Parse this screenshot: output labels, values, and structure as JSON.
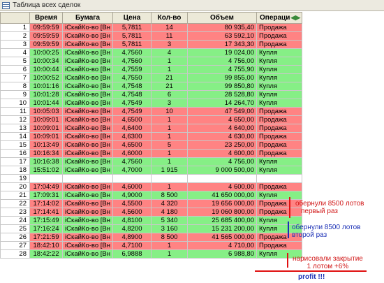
{
  "window": {
    "title": "Таблица всех сделок"
  },
  "table": {
    "columns": {
      "time": "Время",
      "security": "Бумага",
      "price": "Цена",
      "qty": "Кол-во",
      "volume": "Объем",
      "operation": "Операци"
    },
    "rows": [
      {
        "n": "1",
        "time": "09:59:59",
        "security": "iСкайКо-во [Вн",
        "price": "5,7811",
        "qty": "14",
        "volume": "80 935,40",
        "op": "Продажа",
        "side": "sell"
      },
      {
        "n": "2",
        "time": "09:59:59",
        "security": "iСкайКо-во [Вн",
        "price": "5,7811",
        "qty": "11",
        "volume": "63 592,10",
        "op": "Продажа",
        "side": "sell"
      },
      {
        "n": "3",
        "time": "09:59:59",
        "security": "iСкайКо-во [Вн",
        "price": "5,7811",
        "qty": "3",
        "volume": "17 343,30",
        "op": "Продажа",
        "side": "sell"
      },
      {
        "n": "4",
        "time": "10:00:25",
        "security": "iСкайКо-во [Вн",
        "price": "4,7560",
        "qty": "4",
        "volume": "19 024,00",
        "op": "Купля",
        "side": "buy"
      },
      {
        "n": "5",
        "time": "10:00:34",
        "security": "iСкайКо-во [Вн",
        "price": "4,7560",
        "qty": "1",
        "volume": "4 756,00",
        "op": "Купля",
        "side": "buy"
      },
      {
        "n": "6",
        "time": "10:00:44",
        "security": "iСкайКо-во [Вн",
        "price": "4,7559",
        "qty": "1",
        "volume": "4 755,90",
        "op": "Купля",
        "side": "buy"
      },
      {
        "n": "7",
        "time": "10:00:52",
        "security": "iСкайКо-во [Вн",
        "price": "4,7550",
        "qty": "21",
        "volume": "99 855,00",
        "op": "Купля",
        "side": "buy"
      },
      {
        "n": "8",
        "time": "10:01:16",
        "security": "iСкайКо-во [Вн",
        "price": "4,7548",
        "qty": "21",
        "volume": "99 850,80",
        "op": "Купля",
        "side": "buy"
      },
      {
        "n": "9",
        "time": "10:01:28",
        "security": "iСкайКо-во [Вн",
        "price": "4,7548",
        "qty": "6",
        "volume": "28 528,80",
        "op": "Купля",
        "side": "buy"
      },
      {
        "n": "10",
        "time": "10:01:44",
        "security": "iСкайКо-во [Вн",
        "price": "4,7549",
        "qty": "3",
        "volume": "14 264,70",
        "op": "Купля",
        "side": "buy"
      },
      {
        "n": "11",
        "time": "10:05:03",
        "security": "iСкайКо-во [Вн",
        "price": "4,7549",
        "qty": "10",
        "volume": "47 549,00",
        "op": "Продажа",
        "side": "sell"
      },
      {
        "n": "12",
        "time": "10:09:01",
        "security": "iСкайКо-во [Вн",
        "price": "4,6500",
        "qty": "1",
        "volume": "4 650,00",
        "op": "Продажа",
        "side": "sell"
      },
      {
        "n": "13",
        "time": "10:09:01",
        "security": "iСкайКо-во [Вн",
        "price": "4,6400",
        "qty": "1",
        "volume": "4 640,00",
        "op": "Продажа",
        "side": "sell"
      },
      {
        "n": "14",
        "time": "10:09:01",
        "security": "iСкайКо-во [Вн",
        "price": "4,6300",
        "qty": "1",
        "volume": "4 630,00",
        "op": "Продажа",
        "side": "sell"
      },
      {
        "n": "15",
        "time": "10:13:49",
        "security": "iСкайКо-во [Вн",
        "price": "4,6500",
        "qty": "5",
        "volume": "23 250,00",
        "op": "Продажа",
        "side": "sell"
      },
      {
        "n": "16",
        "time": "10:16:34",
        "security": "iСкайКо-во [Вн",
        "price": "4,6000",
        "qty": "1",
        "volume": "4 600,00",
        "op": "Продажа",
        "side": "sell"
      },
      {
        "n": "17",
        "time": "10:16:38",
        "security": "iСкайКо-во [Вн",
        "price": "4,7560",
        "qty": "1",
        "volume": "4 756,00",
        "op": "Купля",
        "side": "buy"
      },
      {
        "n": "18",
        "time": "15:51:02",
        "security": "iСкайКо-во [Вн",
        "price": "4,7000",
        "qty": "1 915",
        "volume": "9 000 500,00",
        "op": "Купля",
        "side": "buy"
      },
      {
        "n": "19",
        "time": "",
        "security": "",
        "price": "",
        "qty": "",
        "volume": "",
        "op": "",
        "side": "blank"
      },
      {
        "n": "20",
        "time": "17:04:49",
        "security": "iСкайКо-во [Вн",
        "price": "4,6000",
        "qty": "1",
        "volume": "4 600,00",
        "op": "Продажа",
        "side": "sell"
      },
      {
        "n": "21",
        "time": "17:09:31",
        "security": "iСкайКо-во [Вн",
        "price": "4,9000",
        "qty": "8 500",
        "volume": "41 650 000,00",
        "op": "Купля",
        "side": "buy"
      },
      {
        "n": "22",
        "time": "17:14:02",
        "security": "iСкайКо-во [Вн",
        "price": "4,5500",
        "qty": "4 320",
        "volume": "19 656 000,00",
        "op": "Продажа",
        "side": "sell"
      },
      {
        "n": "23",
        "time": "17:14:41",
        "security": "iСкайКо-во [Вн",
        "price": "4,5600",
        "qty": "4 180",
        "volume": "19 060 800,00",
        "op": "Продажа",
        "side": "sell"
      },
      {
        "n": "24",
        "time": "17:15:49",
        "security": "iСкайКо-во [Вн",
        "price": "4,8100",
        "qty": "5 340",
        "volume": "25 685 400,00",
        "op": "Купля",
        "side": "buy"
      },
      {
        "n": "25",
        "time": "17:16:24",
        "security": "iСкайКо-во [Вн",
        "price": "4,8200",
        "qty": "3 160",
        "volume": "15 231 200,00",
        "op": "Купля",
        "side": "buy"
      },
      {
        "n": "26",
        "time": "17:21:59",
        "security": "iСкайКо-во [Вн",
        "price": "4,8900",
        "qty": "8 500",
        "volume": "41 565 000,00",
        "op": "Продажа",
        "side": "sell"
      },
      {
        "n": "27",
        "time": "18:42:10",
        "security": "iСкайКо-во [Вн",
        "price": "4,7100",
        "qty": "1",
        "volume": "4 710,00",
        "op": "Продажа",
        "side": "sell"
      },
      {
        "n": "28",
        "time": "18:42:22",
        "security": "iСкайКо-во [Вн",
        "price": "6,9888",
        "qty": "1",
        "volume": "6 988,80",
        "op": "Купля",
        "side": "buy"
      }
    ]
  },
  "annotations": {
    "first_wrap_line1": "обернули 8500 лотов",
    "first_wrap_line2": "первый раз",
    "second_wrap_line1": "обернули 8500 лотов",
    "second_wrap_line2": "второй раз",
    "close_line1": "нарисовали закрытие",
    "close_line2": "1 лотом +6%",
    "profit": "profit !!!"
  },
  "colors": {
    "sell": "#ff8383",
    "buy": "#86ef86",
    "annotation_red": "#d11818",
    "annotation_blue": "#1a2fb5"
  }
}
